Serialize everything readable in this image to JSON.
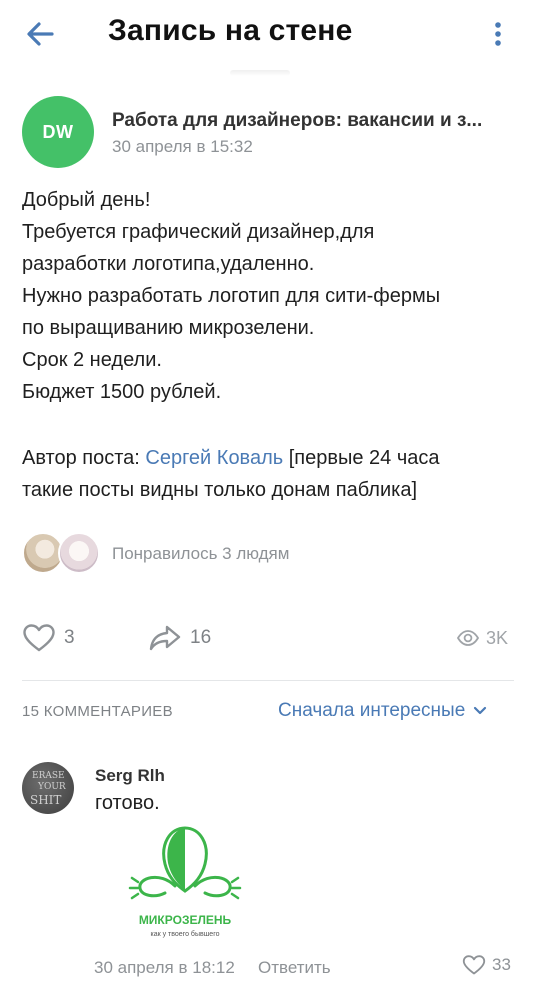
{
  "header": {
    "title": "Запись на стене",
    "back_icon": "arrow-left-icon",
    "more_icon": "more-vertical-icon",
    "accent": "#4a7ab5"
  },
  "post": {
    "group_avatar_text": "DW",
    "group_avatar_color": "#44c168",
    "group_name": "Работа для дизайнеров: вакансии и з...",
    "date": "30 апреля в 15:32",
    "text_lines": [
      "Добрый день!",
      "Требуется графический дизайнер,для",
      "разработки логотипа,удаленно.",
      "Нужно разработать логотип для сити-фермы",
      "по выращиванию микрозелени.",
      "Срок 2 недели.",
      "Бюджет 1500 рублей."
    ],
    "author_prefix": "Автор поста: ",
    "author_name": "Сергей Коваль",
    "author_suffix_1": "  [первые 24 часа",
    "author_suffix_2": "такие посты видны только донам паблика]",
    "liked_by": "Понравилось 3 людям",
    "likes": "3",
    "shares": "16",
    "views": "3K"
  },
  "comments_section": {
    "count_label": "15 КОММЕНТАРИЕВ",
    "sort_label": "Сначала интересные"
  },
  "comment": {
    "avatar_text": [
      "ERASE",
      "YOUR",
      "SHIT"
    ],
    "author": "Serg Rlh",
    "text": "готово.",
    "sticker_title": "МИКРОЗЕЛЕНЬ",
    "sticker_subtitle": "как у твоего бывшего",
    "sticker_color": "#3cb54a",
    "date": "30 апреля в 18:12",
    "reply_label": "Ответить",
    "likes": "33"
  }
}
